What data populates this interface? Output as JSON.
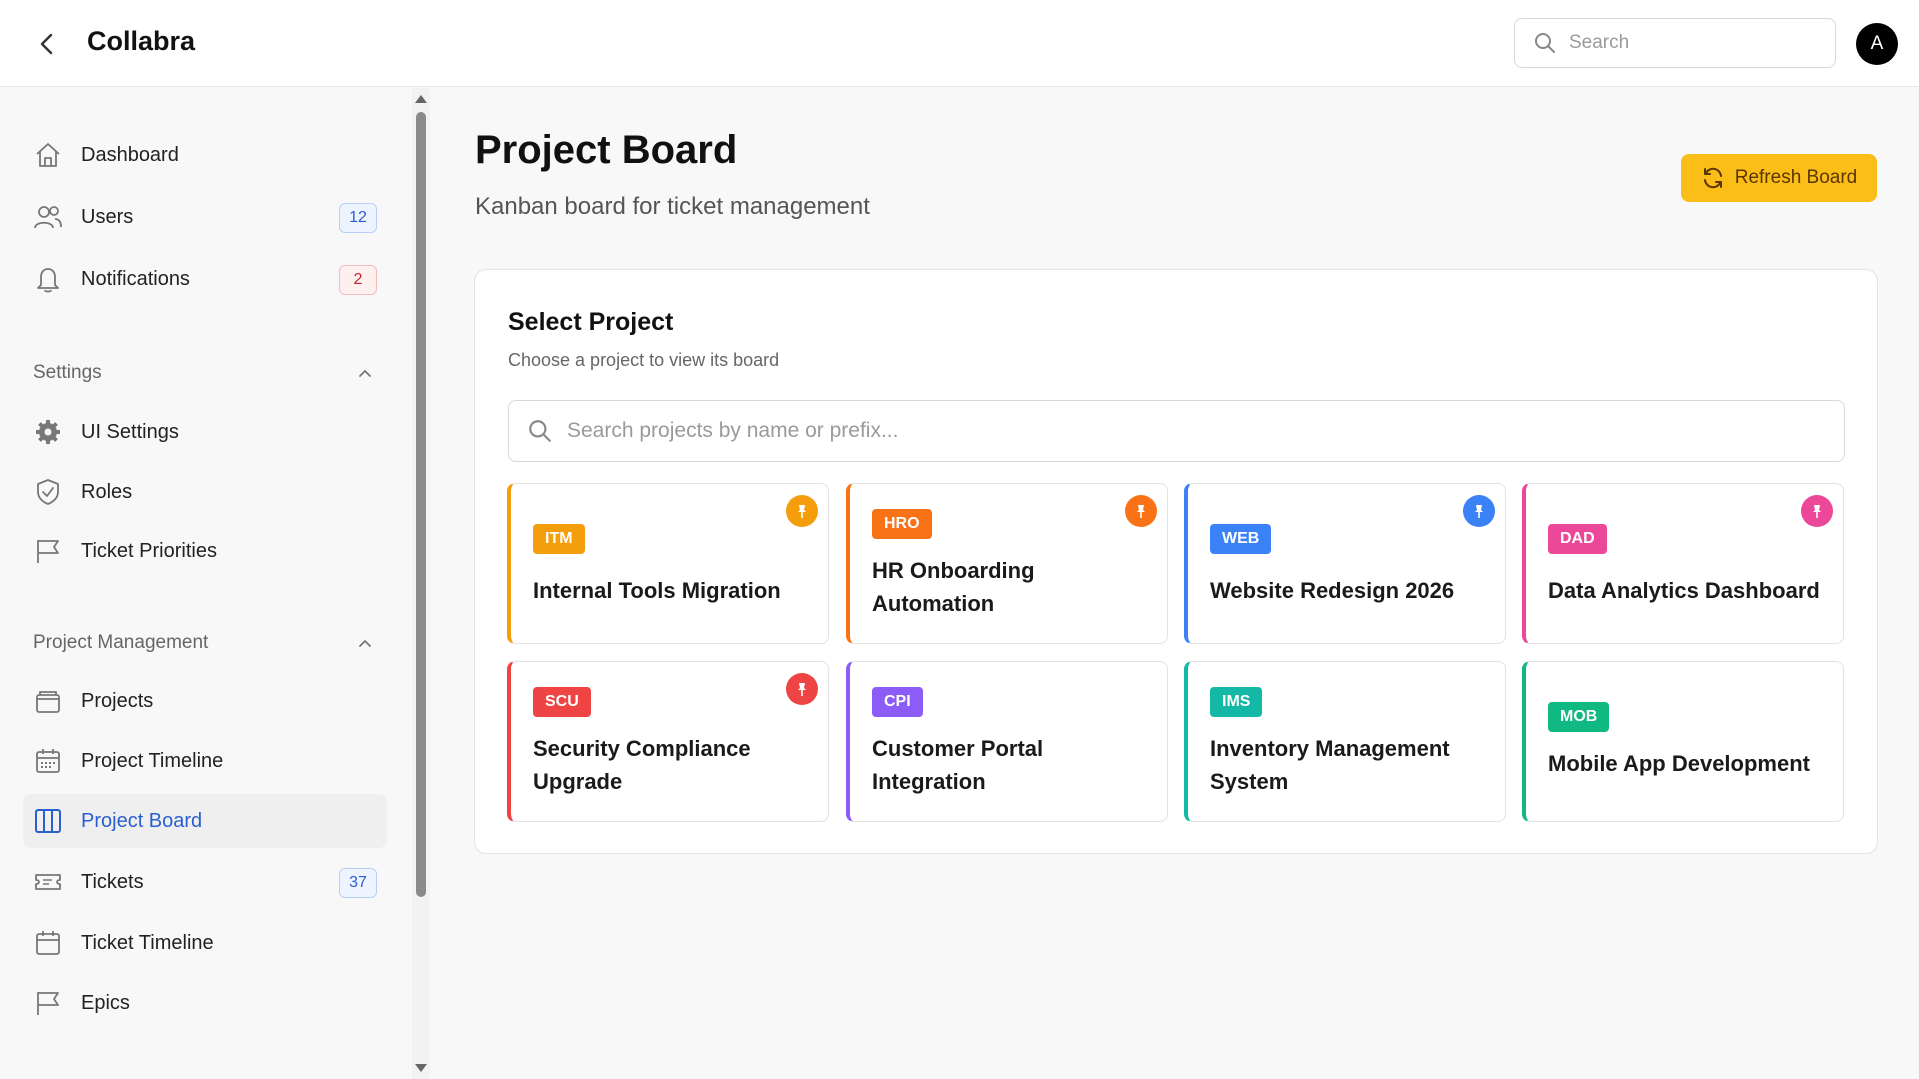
{
  "header": {
    "title": "Collabra",
    "search_placeholder": "Search",
    "avatar_initial": "A"
  },
  "sidebar": {
    "items": [
      {
        "label": "Dashboard",
        "icon": "home-icon"
      },
      {
        "label": "Users",
        "icon": "users-icon",
        "badge": "12"
      },
      {
        "label": "Notifications",
        "icon": "bell-icon",
        "badge": "2"
      }
    ],
    "settings": {
      "heading": "Settings",
      "items": [
        {
          "label": "UI Settings",
          "icon": "gear-icon"
        },
        {
          "label": "Roles",
          "icon": "shield-icon"
        },
        {
          "label": "Ticket Priorities",
          "icon": "flag-icon"
        }
      ]
    },
    "project_management": {
      "heading": "Project Management",
      "items": [
        {
          "label": "Projects",
          "icon": "folder-icon"
        },
        {
          "label": "Project Timeline",
          "icon": "calendar-icon"
        },
        {
          "label": "Project Board",
          "icon": "columns-icon",
          "active": true
        },
        {
          "label": "Tickets",
          "icon": "ticket-icon",
          "badge": "37"
        },
        {
          "label": "Ticket Timeline",
          "icon": "calendar-icon"
        },
        {
          "label": "Epics",
          "icon": "flag-icon"
        }
      ]
    }
  },
  "main": {
    "title": "Project Board",
    "subtitle": "Kanban board for ticket management",
    "refresh_label": "Refresh Board",
    "panel": {
      "title": "Select Project",
      "subtitle": "Choose a project to view its board",
      "search_placeholder": "Search projects by name or prefix..."
    },
    "projects": [
      {
        "prefix": "ITM",
        "name": "Internal Tools Migration",
        "color": "#f59e0b",
        "pinned": true
      },
      {
        "prefix": "HRO",
        "name": "HR Onboarding Automation",
        "color": "#f97316",
        "pinned": true
      },
      {
        "prefix": "WEB",
        "name": "Website Redesign 2026",
        "color": "#3b82f6",
        "pinned": true
      },
      {
        "prefix": "DAD",
        "name": "Data Analytics Dashboard",
        "color": "#ec4899",
        "pinned": true
      },
      {
        "prefix": "SCU",
        "name": "Security Compliance Upgrade",
        "color": "#ef4444",
        "pinned": true
      },
      {
        "prefix": "CPI",
        "name": "Customer Portal Integration",
        "color": "#8b5cf6",
        "pinned": false
      },
      {
        "prefix": "IMS",
        "name": "Inventory Management System",
        "color": "#14b8a6",
        "pinned": false
      },
      {
        "prefix": "MOB",
        "name": "Mobile App Development",
        "color": "#10b981",
        "pinned": false
      }
    ]
  },
  "colors": {
    "accent_yellow": "#fbbd18",
    "active_blue": "#2b5fd0"
  }
}
